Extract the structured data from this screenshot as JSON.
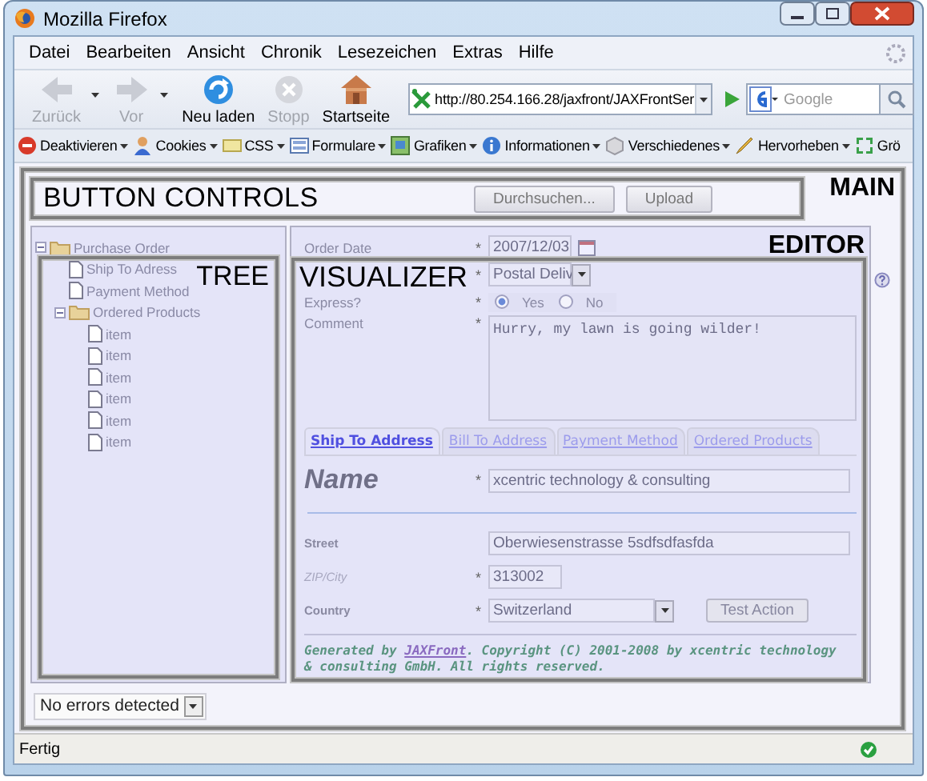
{
  "window": {
    "title": "Mozilla Firefox"
  },
  "menu": [
    "Datei",
    "Bearbeiten",
    "Ansicht",
    "Chronik",
    "Lesezeichen",
    "Extras",
    "Hilfe"
  ],
  "nav_buttons": [
    {
      "label": "Zurück",
      "kind": "back",
      "disabled": true
    },
    {
      "label": "Vor",
      "kind": "forward",
      "disabled": true
    },
    {
      "label": "Neu laden",
      "kind": "reload",
      "disabled": false
    },
    {
      "label": "Stopp",
      "kind": "stop",
      "disabled": true
    },
    {
      "label": "Startseite",
      "kind": "home",
      "disabled": false
    }
  ],
  "url": {
    "value": "http://80.254.166.28/jaxfront/JAXFrontSer"
  },
  "search": {
    "placeholder": "Google"
  },
  "bookmarks": [
    {
      "label": "Deaktivieren",
      "kind": "disable"
    },
    {
      "label": "Cookies",
      "kind": "cookies"
    },
    {
      "label": "CSS",
      "kind": "css"
    },
    {
      "label": "Formulare",
      "kind": "forms"
    },
    {
      "label": "Grafiken",
      "kind": "images"
    },
    {
      "label": "Informationen",
      "kind": "info"
    },
    {
      "label": "Verschiedenes",
      "kind": "misc"
    },
    {
      "label": "Hervorheben",
      "kind": "highlight"
    },
    {
      "label": "Grö",
      "kind": "resize"
    }
  ],
  "annotations": {
    "main": "MAIN",
    "button_controls": "BUTTON CONTROLS",
    "editor": "EDITOR",
    "tree": "TREE",
    "visualizer": "VISUALIZER"
  },
  "button_bar": {
    "buttons": [
      "Durchsuchen...",
      "Upload"
    ]
  },
  "tree": {
    "items": [
      {
        "label": "Purchase Order",
        "expanded": true,
        "children": [
          {
            "label": "Ship To Adress"
          },
          {
            "label": "Payment Method"
          },
          {
            "label": "Ordered Products",
            "expanded": true,
            "children": [
              {
                "label": "item"
              },
              {
                "label": "item"
              },
              {
                "label": "item"
              },
              {
                "label": "item"
              },
              {
                "label": "item"
              },
              {
                "label": "item"
              }
            ]
          }
        ]
      }
    ]
  },
  "editor": {
    "order_date": {
      "label": "Order Date",
      "required_mark": "*",
      "value": "2007/12/03"
    },
    "shipping": {
      "required_mark": "*",
      "value": "Postal Deliv"
    },
    "express": {
      "label": "Express?",
      "required_mark": "*",
      "options": [
        {
          "label": "Yes",
          "selected": true
        },
        {
          "label": "No",
          "selected": false
        }
      ]
    },
    "comment": {
      "label": "Comment",
      "required_mark": "*",
      "value": "Hurry, my lawn is going wilder!"
    },
    "tabs": [
      {
        "label": "Ship To Address",
        "selected": true
      },
      {
        "label": "Bill To Address",
        "selected": false
      },
      {
        "label": "Payment Method",
        "selected": false
      },
      {
        "label": "Ordered Products",
        "selected": false
      }
    ],
    "name": {
      "label": "Name",
      "required_mark": "*",
      "value": "xcentric technology & consulting"
    },
    "address": [
      {
        "label": "Street",
        "kind": "text",
        "value": "Oberwiesenstrasse 5sdfsdfasfda"
      },
      {
        "label": "ZIP/City",
        "kind": "short",
        "required_mark": "*",
        "value": "313002"
      },
      {
        "label": "Country",
        "kind": "select",
        "required_mark": "*",
        "value": "Switzerland"
      }
    ],
    "action_button": "Test Action",
    "footer": {
      "before": "Generated by ",
      "link": "JAXFront",
      "after": ". Copyright (C) 2001-2008 by xcentric technology & consulting GmbH. All rights reserved."
    }
  },
  "errors": {
    "value": "No errors detected"
  },
  "status_bar": {
    "text": "Fertig"
  }
}
